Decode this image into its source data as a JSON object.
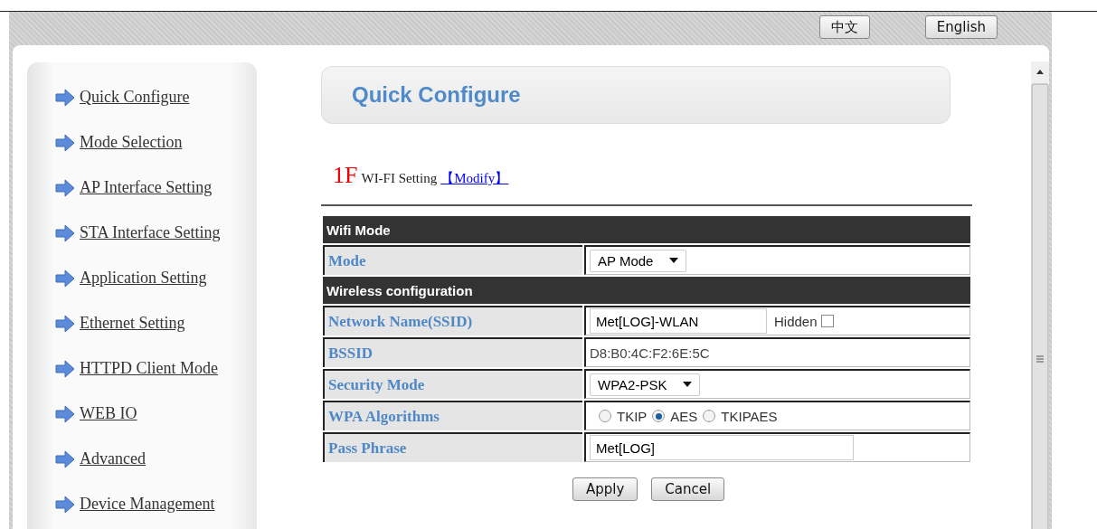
{
  "languages": [
    {
      "label": "中文"
    },
    {
      "label": "English"
    }
  ],
  "sidebar": {
    "items": [
      {
        "label": "Quick Configure"
      },
      {
        "label": "Mode Selection"
      },
      {
        "label": "AP Interface Setting"
      },
      {
        "label": "STA Interface Setting"
      },
      {
        "label": "Application Setting"
      },
      {
        "label": "Ethernet Setting"
      },
      {
        "label": "HTTPD Client Mode"
      },
      {
        "label": "WEB IO"
      },
      {
        "label": "Advanced"
      },
      {
        "label": "Device Management"
      }
    ]
  },
  "page_title": "Quick Configure",
  "section": {
    "number": "1F",
    "title": "WI-FI Setting",
    "link": "【Modify】"
  },
  "table": {
    "rows": [
      {
        "kind": "header",
        "label": "Wifi Mode"
      },
      {
        "kind": "select",
        "label": "Mode",
        "value": "AP Mode"
      },
      {
        "kind": "header",
        "label": "Wireless configuration"
      },
      {
        "kind": "input",
        "label": "Network Name(SSID)",
        "value": "Met[LOG]-WLAN",
        "checkbox": {
          "label": "Hidden",
          "checked": false
        }
      },
      {
        "kind": "static",
        "label": "BSSID",
        "value": "D8:B0:4C:F2:6E:5C"
      },
      {
        "kind": "select",
        "label": "Security Mode",
        "value": "WPA2-PSK"
      },
      {
        "kind": "radio",
        "label": "WPA Algorithms",
        "options": [
          {
            "label": "TKIP",
            "selected": false
          },
          {
            "label": "AES",
            "selected": true
          },
          {
            "label": "TKIPAES",
            "selected": false
          }
        ]
      },
      {
        "kind": "input",
        "label": "Pass Phrase",
        "value": "Met[LOG]"
      }
    ]
  },
  "buttons": [
    {
      "label": "Apply"
    },
    {
      "label": "Cancel"
    }
  ]
}
